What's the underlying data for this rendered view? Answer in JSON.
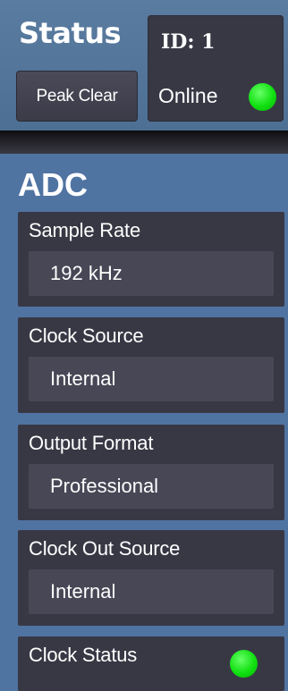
{
  "status": {
    "title": "Status",
    "peak_clear_label": "Peak Clear",
    "id_label": "ID: 1",
    "online_label": "Online",
    "online_led_color": "#11e011"
  },
  "adc": {
    "title": "ADC",
    "sample_rate": {
      "label": "Sample Rate",
      "value": "192 kHz"
    },
    "clock_source": {
      "label": "Clock Source",
      "value": "Internal"
    },
    "output_format": {
      "label": "Output Format",
      "value": "Professional"
    },
    "clock_out_source": {
      "label": "Clock Out Source",
      "value": "Internal"
    },
    "clock_status": {
      "label": "Clock Status",
      "led_color": "#11e011"
    }
  },
  "colors": {
    "panel_blue": "#4f7195",
    "card_dark": "#383845",
    "value_box": "#474756",
    "button": "#43434f",
    "led_green": "#11e011"
  }
}
